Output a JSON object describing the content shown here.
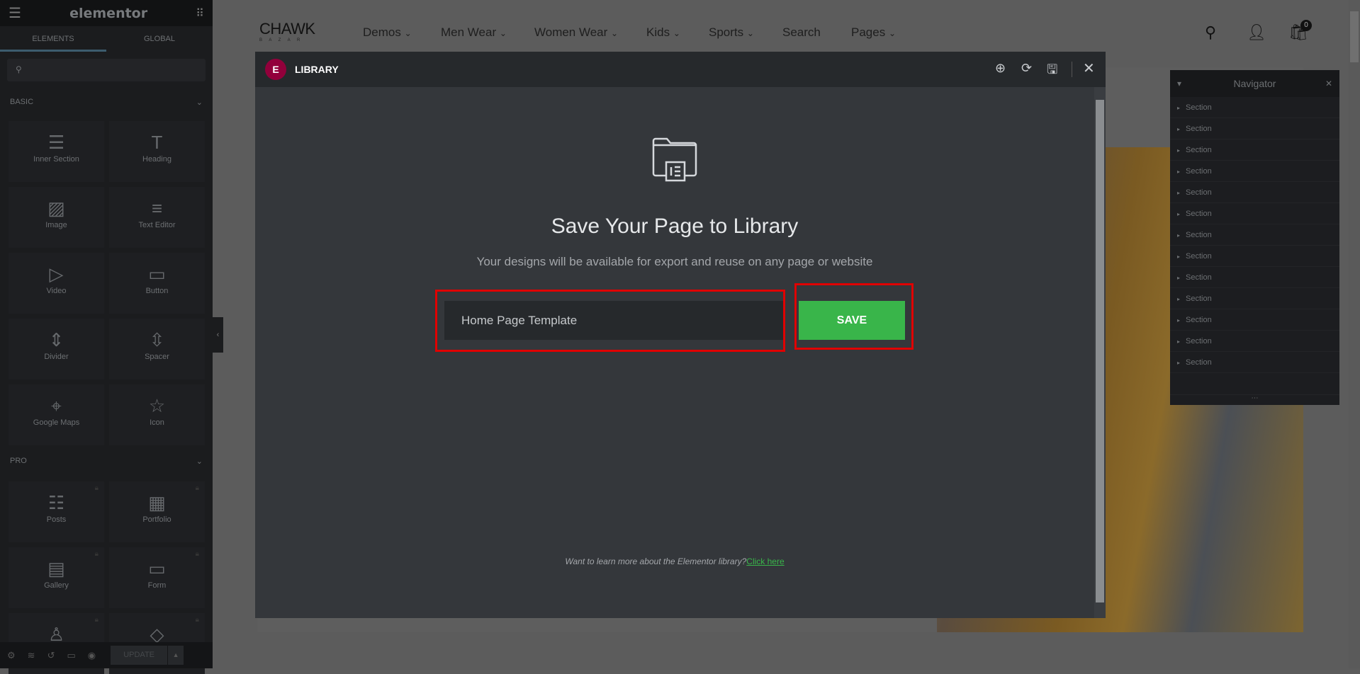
{
  "sidebar": {
    "logo": "elementor",
    "tabs": [
      "ELEMENTS",
      "GLOBAL"
    ],
    "search_placeholder": "",
    "basic_label": "BASIC",
    "pro_label": "PRO",
    "basic_widgets": [
      {
        "label": "Inner Section",
        "icon": "inner-section-icon",
        "glyph": "☰"
      },
      {
        "label": "Heading",
        "icon": "heading-icon",
        "glyph": "T"
      },
      {
        "label": "Image",
        "icon": "image-icon",
        "glyph": "▨"
      },
      {
        "label": "Text Editor",
        "icon": "text-editor-icon",
        "glyph": "≡"
      },
      {
        "label": "Video",
        "icon": "video-icon",
        "glyph": "▷"
      },
      {
        "label": "Button",
        "icon": "button-icon",
        "glyph": "▭"
      },
      {
        "label": "Divider",
        "icon": "divider-icon",
        "glyph": "⇕"
      },
      {
        "label": "Spacer",
        "icon": "spacer-icon",
        "glyph": "⇳"
      },
      {
        "label": "Google Maps",
        "icon": "map-icon",
        "glyph": "⌖"
      },
      {
        "label": "Icon",
        "icon": "star-icon",
        "glyph": "☆"
      }
    ],
    "pro_widgets": [
      {
        "label": "Posts",
        "icon": "posts-icon",
        "glyph": "☷"
      },
      {
        "label": "Portfolio",
        "icon": "portfolio-icon",
        "glyph": "▦"
      },
      {
        "label": "Gallery",
        "icon": "gallery-icon",
        "glyph": "▤"
      },
      {
        "label": "Form",
        "icon": "form-icon",
        "glyph": "▭"
      },
      {
        "label": "",
        "icon": "login-icon",
        "glyph": "♙"
      },
      {
        "label": "",
        "icon": "slides-icon",
        "glyph": "◇"
      }
    ],
    "update_label": "UPDATE"
  },
  "site": {
    "logo": "CHAWK",
    "logo_sub": "B A Z A R",
    "nav": [
      "Demos",
      "Men Wear",
      "Women Wear",
      "Kids",
      "Sports",
      "Search",
      "Pages"
    ],
    "cart_count": "0"
  },
  "modal": {
    "title": "LIBRARY",
    "heading": "Save Your Page to Library",
    "subheading": "Your designs will be available for export and reuse on any page or website",
    "input_value": "Home Page Template",
    "save_label": "SAVE",
    "footer_text": "Want to learn more about the Elementor library?",
    "footer_link": "Click here",
    "colors": {
      "accent": "#39b54a",
      "brand": "#92003b",
      "highlight": "#e00000"
    }
  },
  "navigator": {
    "title": "Navigator",
    "items": [
      "Section",
      "Section",
      "Section",
      "Section",
      "Section",
      "Section",
      "Section",
      "Section",
      "Section",
      "Section",
      "Section",
      "Section",
      "Section"
    ]
  }
}
